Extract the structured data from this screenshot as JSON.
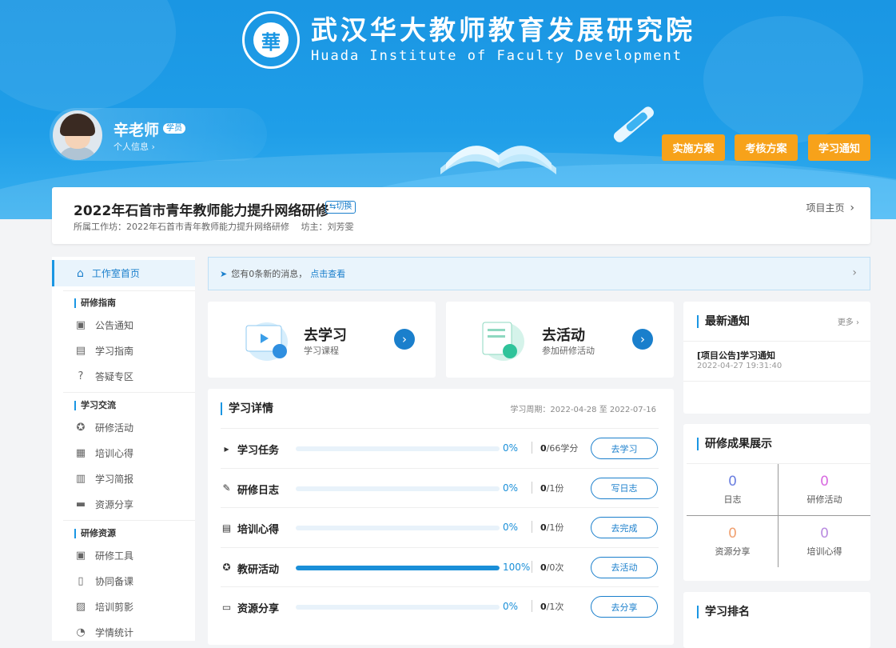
{
  "header": {
    "logo_mark": "華",
    "title_cn": "武汉华大教师教育发展研究院",
    "title_en": "Huada Institute of Faculty Development"
  },
  "user": {
    "name": "辛老师",
    "badge": "学员",
    "info_link": "个人信息 ›"
  },
  "hero_buttons": [
    "实施方案",
    "考核方案",
    "学习通知"
  ],
  "project": {
    "title": "2022年石首市青年教师能力提升网络研修",
    "switch_label": "⇆切换",
    "subtitle": "所属工作坊：2022年石首市青年教师能力提升网络研修　 坊主：刘芳雯",
    "home_link": "项目主页"
  },
  "sidebar": {
    "home": "工作室首页",
    "sections": [
      {
        "title": "研修指南",
        "items": [
          "公告通知",
          "学习指南",
          "答疑专区"
        ]
      },
      {
        "title": "学习交流",
        "items": [
          "研修活动",
          "培训心得",
          "学习简报",
          "资源分享"
        ]
      },
      {
        "title": "研修资源",
        "items": [
          "研修工具",
          "协同备课",
          "培训剪影",
          "学情统计"
        ]
      }
    ]
  },
  "message_bar": {
    "text": "您有0条新的消息，",
    "link": "点击查看"
  },
  "quick_cards": [
    {
      "title": "去学习",
      "sub": "学习课程"
    },
    {
      "title": "去活动",
      "sub": "参加研修活动"
    }
  ],
  "study_detail": {
    "title": "学习详情",
    "period": "学习周期：2022-04-28 至 2022-07-16",
    "rows": [
      {
        "name": "学习任务",
        "icon": "play-icon",
        "progress": 0,
        "pct": "0%",
        "done": "0",
        "total": "/66学分",
        "button": "去学习"
      },
      {
        "name": "研修日志",
        "icon": "pen-icon",
        "progress": 0,
        "pct": "0%",
        "done": "0",
        "total": "/1份",
        "button": "写日志"
      },
      {
        "name": "培训心得",
        "icon": "doc-icon",
        "progress": 0,
        "pct": "0%",
        "done": "0",
        "total": "/1份",
        "button": "去完成"
      },
      {
        "name": "教研活动",
        "icon": "star-icon",
        "progress": 100,
        "pct": "100%",
        "done": "0",
        "total": "/0次",
        "button": "去活动"
      },
      {
        "name": "资源分享",
        "icon": "folder-icon",
        "progress": 0,
        "pct": "0%",
        "done": "0",
        "total": "/1次",
        "button": "去分享"
      }
    ]
  },
  "notices": {
    "title": "最新通知",
    "more": "更多 ›",
    "items": [
      {
        "title": "[项目公告]学习通知",
        "time": "2022-04-27 19:31:40"
      }
    ]
  },
  "achievements": {
    "title": "研修成果展示",
    "cells": [
      {
        "value": "0",
        "label": "日志",
        "color": "#6b7fe0"
      },
      {
        "value": "0",
        "label": "研修活动",
        "color": "#d86ae0"
      },
      {
        "value": "0",
        "label": "资源分享",
        "color": "#f0a070"
      },
      {
        "value": "0",
        "label": "培训心得",
        "color": "#b98be0"
      }
    ]
  },
  "ranking": {
    "title": "学习排名"
  },
  "colors": {
    "primary": "#1a96e3",
    "accent": "#f7a21a",
    "link": "#1a7fcc"
  }
}
